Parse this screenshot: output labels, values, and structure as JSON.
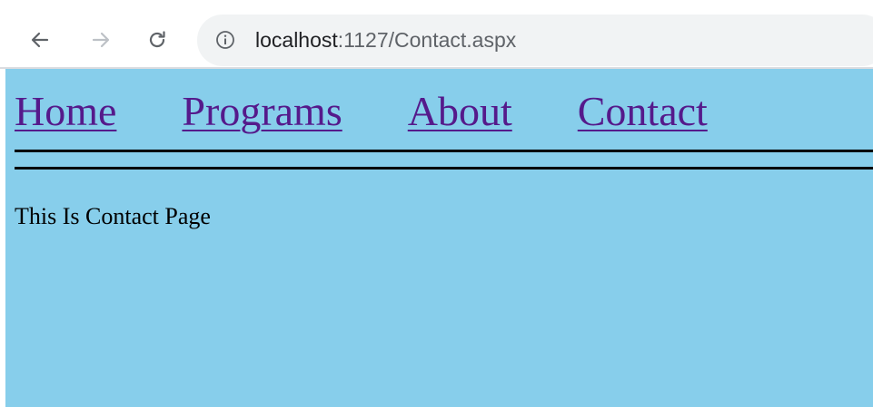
{
  "toolbar": {
    "back_icon": "arrow-left-icon",
    "forward_icon": "arrow-right-icon",
    "reload_icon": "reload-icon",
    "info_icon": "info-circle-icon"
  },
  "address_bar": {
    "host": "localhost",
    "rest": ":1127/Contact.aspx"
  },
  "nav": {
    "items": [
      {
        "label": "Home"
      },
      {
        "label": "Programs"
      },
      {
        "label": "About"
      },
      {
        "label": "Contact"
      }
    ]
  },
  "content": {
    "body_text": "This Is Contact Page"
  },
  "colors": {
    "page_background": "#87ceeb",
    "link": "#551a8b",
    "omnibox": "#f1f3f4"
  }
}
